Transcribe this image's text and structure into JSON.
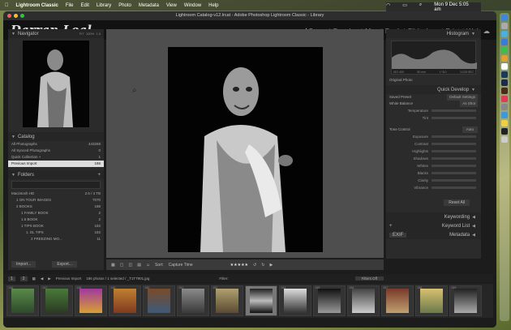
{
  "menubar": {
    "apple": "",
    "app": "Lightroom Classic",
    "items": [
      "File",
      "Edit",
      "Library",
      "Photo",
      "Metadata",
      "View",
      "Window",
      "Help"
    ],
    "datetime": "Mon 9 Dec  5:05 am"
  },
  "window": {
    "title": "Lightroom Catalog-v12.lrcat - Adobe Photoshop Lightroom Classic - Library"
  },
  "identity_plate": "Darran Leal",
  "modules": [
    "Library",
    "Develop",
    "Map",
    "Book",
    "Slideshow",
    "Print",
    "Web"
  ],
  "active_module": "Library",
  "left_panel": {
    "navigator_label": "Navigator",
    "navigator_zoom": [
      "FIT",
      "100%",
      "1:3"
    ],
    "catalog_label": "Catalog",
    "catalog_items": [
      {
        "label": "All Photographs",
        "count": "443268"
      },
      {
        "label": "All Synced Photographs",
        "count": "0"
      },
      {
        "label": "Quick Collection +",
        "count": "1"
      },
      {
        "label": "Previous Import",
        "count": "186"
      }
    ],
    "folders_label": "Folders",
    "volume": {
      "label": "Macintosh HD",
      "space": "2.6 / 4 TB"
    },
    "folders": [
      {
        "label": "1 ON TOUR IMAGES",
        "count": "7070"
      },
      {
        "label": "2 BOOKS",
        "count": "186"
      },
      {
        "label": "1 FAMILY BOOK",
        "count": "2"
      },
      {
        "label": "1.5 BOOK",
        "count": "2"
      },
      {
        "label": "1 TIPS BOOK",
        "count": "182"
      },
      {
        "label": "1. DL TIPS",
        "count": "182"
      },
      {
        "label": "2 FREEZING MO...",
        "count": "11"
      }
    ],
    "import_label": "Import...",
    "export_label": "Export..."
  },
  "right_panel": {
    "histogram_label": "Histogram",
    "histogram_info": [
      "ISO 400",
      "50 mm",
      "f / 8.0",
      "1/125 SEC"
    ],
    "original_photo": "Original Photo",
    "quick_develop_label": "Quick Develop",
    "saved_preset": {
      "label": "Saved Preset",
      "value": "Default Settings"
    },
    "white_balance": {
      "label": "White Balance",
      "value": "As Shot"
    },
    "wb_sliders": [
      "Temperature",
      "Tint"
    ],
    "tone_control": {
      "label": "Tone Control",
      "value": "Auto"
    },
    "tone_sliders": [
      "Exposure",
      "Contrast",
      "Highlights",
      "Shadows",
      "Whites",
      "Blacks",
      "Clarity",
      "Vibrance"
    ],
    "reset_all": "Reset All",
    "keywording_label": "Keywording",
    "keyword_list_label": "Keyword List",
    "metadata_label": "Metadata",
    "metadata_value": "EXIF"
  },
  "toolbar": {
    "sort_label": "Sort:",
    "sort_value": "Capture Time",
    "rating": "★★★★★"
  },
  "filmstrip": {
    "source": "Previous Import",
    "info": "186 photos / 1 selected / _T1T7901.jpg",
    "filter_label": "Filter:",
    "filters_value": "Filters Off",
    "page_numbers": [
      "1",
      "2"
    ],
    "thumbnails": [
      "146",
      "147",
      "148",
      "149",
      "150",
      "151",
      "152",
      "153",
      "154",
      "155",
      "156",
      "157",
      "158",
      "159"
    ],
    "selected_index": "6"
  },
  "colors": {
    "panel": "#2b2b2b",
    "active_module": "#e6e6e6",
    "center_bg": "#4e4e4e"
  }
}
